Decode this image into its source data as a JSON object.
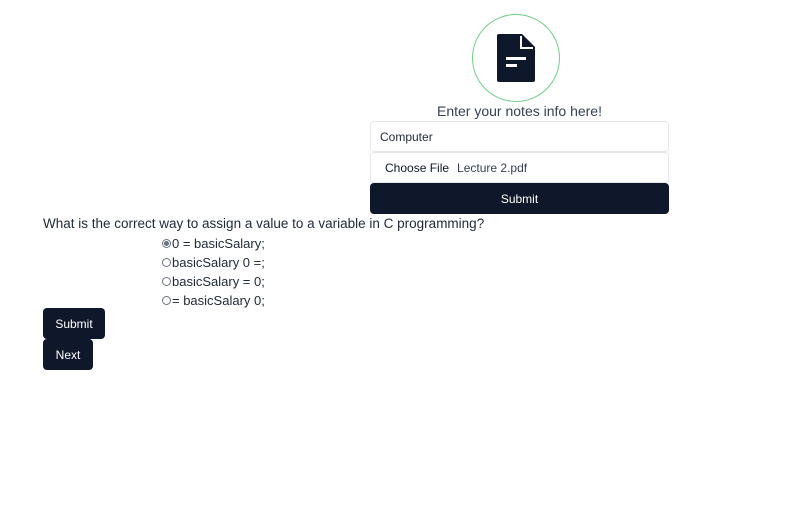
{
  "upload": {
    "icon": "document-icon",
    "title": "Enter your notes info here!",
    "subject_value": "Computer",
    "file_button_label": "Choose File",
    "file_name": "Lecture 2.pdf",
    "submit_label": "Submit"
  },
  "quiz": {
    "question": "What is the correct way to assign a value to a variable in C programming?",
    "options": [
      {
        "label": "0 = basicSalary;",
        "checked": true
      },
      {
        "label": "basicSalary 0 =;",
        "checked": false
      },
      {
        "label": "basicSalary = 0;",
        "checked": false
      },
      {
        "label": "= basicSalary 0;",
        "checked": false
      }
    ],
    "submit_label": "Submit",
    "next_label": "Next"
  },
  "colors": {
    "button_bg": "#0f172a",
    "circle_border": "#6fcf86"
  }
}
